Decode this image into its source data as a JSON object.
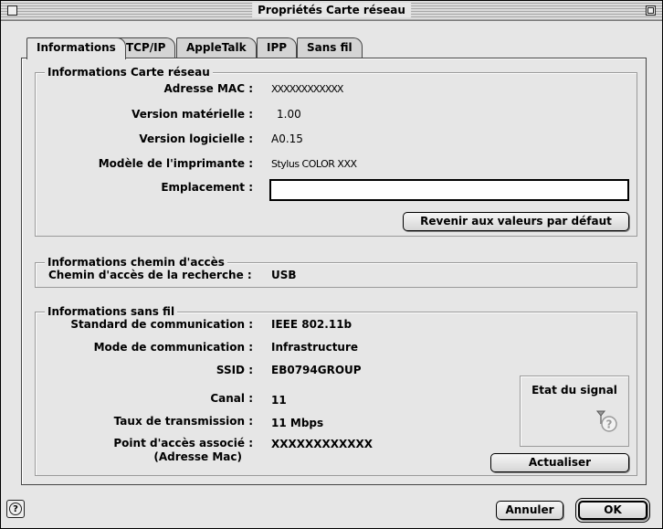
{
  "window": {
    "title": "Propriétés Carte réseau"
  },
  "tabs": [
    "Informations",
    "TCP/IP",
    "AppleTalk",
    "IPP",
    "Sans fil"
  ],
  "network_card_info": {
    "title": "Informations Carte réseau",
    "mac_label": "Adresse MAC :",
    "mac_value": "XXXXXXXXXXXX",
    "hw_version_label": "Version matérielle :",
    "hw_version_value": "1.00",
    "sw_version_label": "Version logicielle :",
    "sw_version_value": "A0.15",
    "printer_model_label": "Modèle de l'imprimante :",
    "printer_model_value": "Stylus COLOR XXX",
    "location_label": "Emplacement :",
    "location_value": "",
    "reset_button": "Revenir aux valeurs par défaut"
  },
  "path_info": {
    "title": "Informations chemin d'accès",
    "search_path_label": "Chemin d'accès de la recherche :",
    "search_path_value": "USB"
  },
  "wireless_info": {
    "title": "Informations sans fil",
    "standard_label": "Standard de communication :",
    "standard_value": "IEEE 802.11b",
    "mode_label": "Mode de communication :",
    "mode_value": "Infrastructure",
    "ssid_label": "SSID :",
    "ssid_value": "EB0794GROUP",
    "channel_label": "Canal :",
    "channel_value": "11",
    "rate_label": "Taux de transmission :",
    "rate_value": "11 Mbps",
    "ap_label_line1": "Point d'accès associé :",
    "ap_label_line2": "(Adresse Mac)",
    "ap_value": "XXXXXXXXXXXX",
    "signal_title": "Etat du signal",
    "signal_icon": "signal-unknown-icon",
    "refresh_button": "Actualiser"
  },
  "footer": {
    "help_icon": "help-icon",
    "cancel_button": "Annuler",
    "ok_button": "OK"
  }
}
